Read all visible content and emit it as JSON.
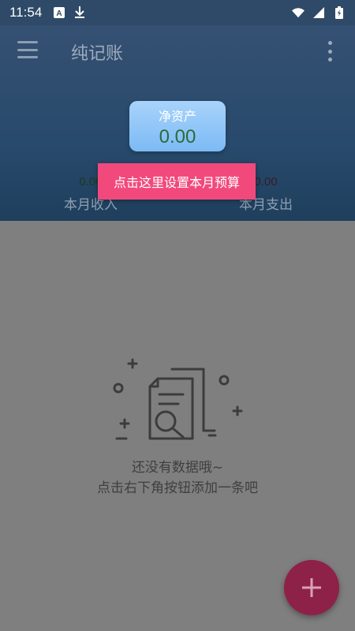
{
  "status_bar": {
    "time": "11:54",
    "left_icons": [
      "font-a-icon",
      "download-icon"
    ],
    "right_icons": [
      "wifi-icon",
      "signal-icon",
      "battery-icon"
    ]
  },
  "app_bar": {
    "title": "纯记账",
    "menu_icon": "menu-icon",
    "more_icon": "more-vert-icon"
  },
  "summary": {
    "net_assets_label": "净资产",
    "net_assets_value": "0.00",
    "income_value": "0.00",
    "income_label": "本月收入",
    "expense_value": "0.00",
    "expense_label": "本月支出"
  },
  "tooltip": {
    "text": "点击这里设置本月预算"
  },
  "empty_state": {
    "icon": "empty-document-search-icon",
    "line1": "还没有数据哦~",
    "line2": "点击右下角按钮添加一条吧"
  },
  "fab": {
    "icon": "plus-icon"
  },
  "colors": {
    "header_bg": "#284a6c",
    "tooltip_bg": "#f2497c",
    "fab_bg": "#8e2148",
    "net_card_bg": "#7cbaf5"
  }
}
